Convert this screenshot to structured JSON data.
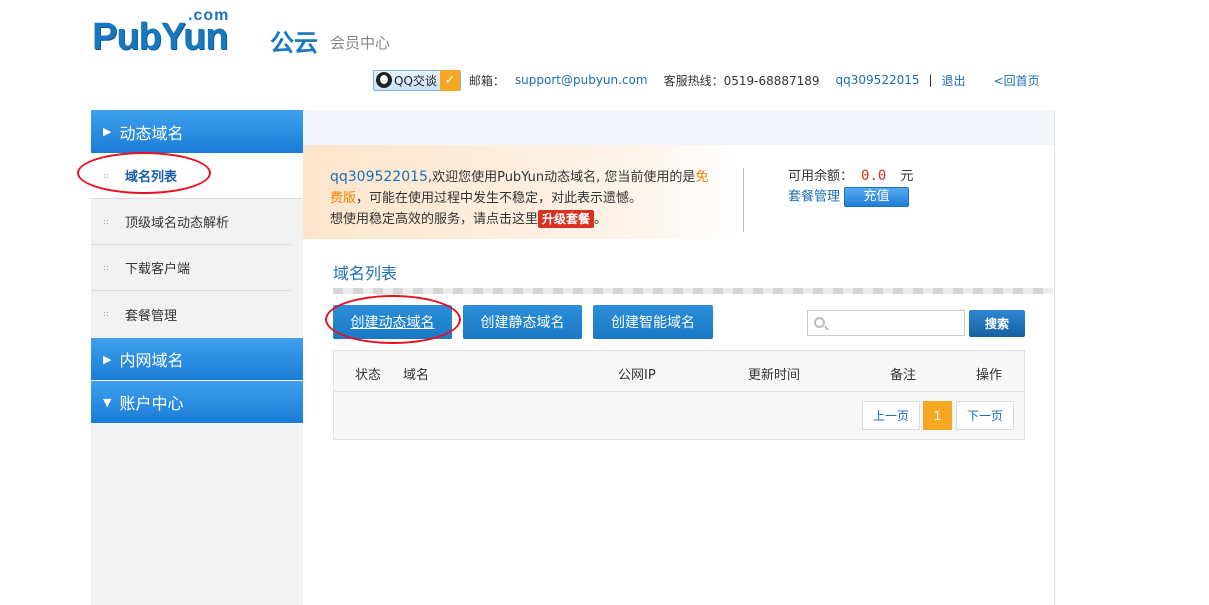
{
  "header": {
    "logo_com": ".com",
    "logo_brand": "PubYun",
    "logo_cn": "公云",
    "logo_sub": "会员中心",
    "qq_label": "QQ交谈",
    "email_label": "邮箱：",
    "email_value": "support@pubyun.com",
    "hotline_label": "客服热线：0519-68887189",
    "username": "qq309522015",
    "separator": "|",
    "logout": "退出",
    "home": "<回首页"
  },
  "sidebar": {
    "section1": "动态域名",
    "items": [
      "域名列表",
      "顶级域名动态解析",
      "下载客户端",
      "套餐管理"
    ],
    "section2": "内网域名",
    "section3": "账户中心"
  },
  "welcome": {
    "username": "qq309522015",
    "line1": ",欢迎您使用PubYun动态域名, 您当前使用的是",
    "free1": "免",
    "free2": "费版",
    "line2": "，可能在使用过程中发生不稳定，对此表示遗憾。",
    "line3": "想使用稳定高效的服务，请点击这里",
    "upgrade": "升级套餐",
    "line3_end": "。"
  },
  "balance": {
    "label": "可用余额：",
    "value": "0.0",
    "unit": "元",
    "plan_link": "套餐管理",
    "recharge": "充值"
  },
  "main": {
    "section_title": "域名列表",
    "buttons": [
      "创建动态域名",
      "创建静态域名",
      "创建智能域名"
    ],
    "search_placeholder": "",
    "search_button": "搜索",
    "columns": [
      "状态",
      "域名",
      "公网IP",
      "更新时间",
      "备注",
      "操作"
    ],
    "pager": {
      "prev": "上一页",
      "current": "1",
      "next": "下一页"
    }
  }
}
